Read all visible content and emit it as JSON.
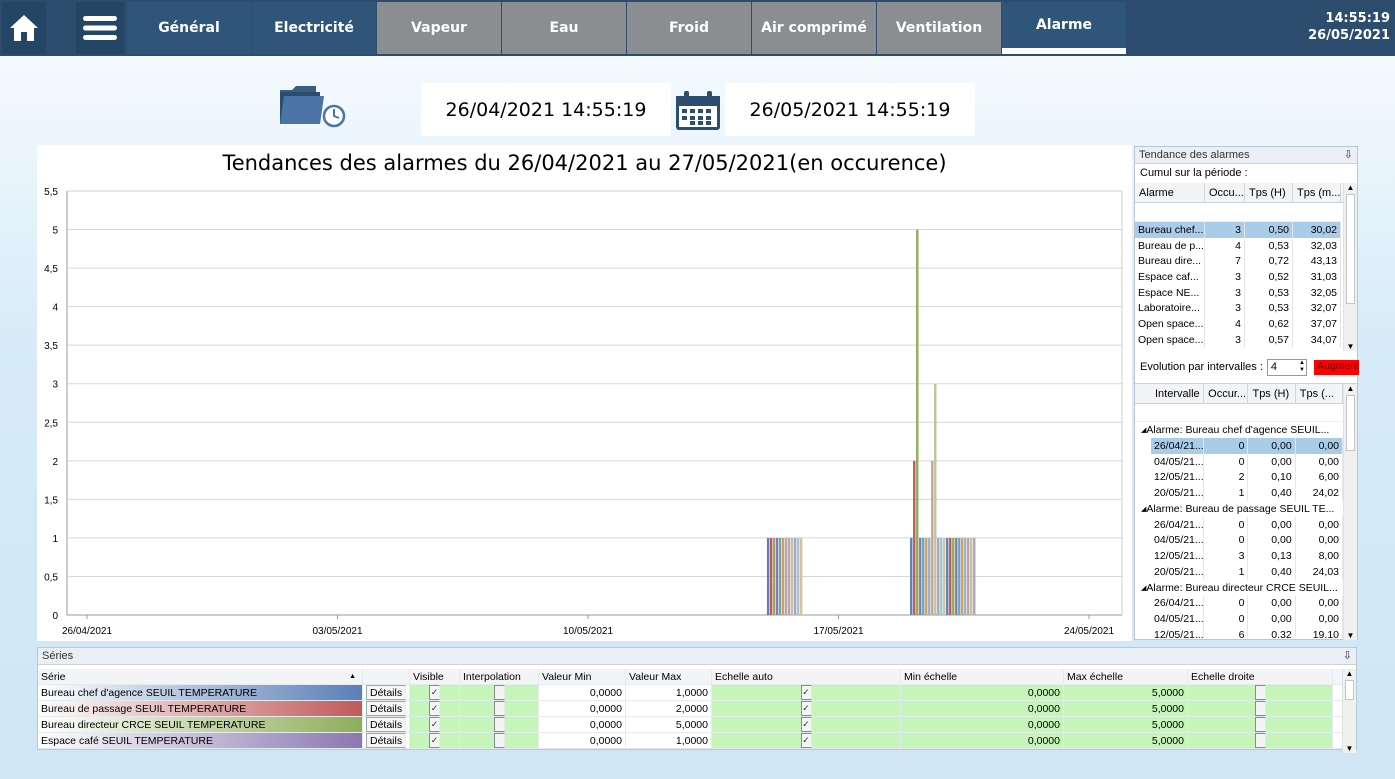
{
  "nav": {
    "tabs": [
      {
        "label": "Général",
        "state": "dark"
      },
      {
        "label": "Electricité",
        "state": "dark"
      },
      {
        "label": "Vapeur",
        "state": "gray"
      },
      {
        "label": "Eau",
        "state": "gray"
      },
      {
        "label": "Froid",
        "state": "gray"
      },
      {
        "label": "Air comprimé",
        "state": "gray"
      },
      {
        "label": "Ventilation",
        "state": "gray"
      },
      {
        "label": "Alarme",
        "state": "active"
      }
    ],
    "time": "14:55:19",
    "date": "26/05/2021"
  },
  "period": {
    "start": "26/04/2021 14:55:19",
    "end": "26/05/2021 14:55:19"
  },
  "chart_data": {
    "type": "bar",
    "title": "Tendances des alarmes du 26/04/2021 au 27/05/2021(en occurence)",
    "ylim": [
      0,
      5.5
    ],
    "yticks": [
      "0",
      "0,5",
      "1",
      "1,5",
      "2",
      "2,5",
      "3",
      "3,5",
      "4",
      "4,5",
      "5",
      "5,5"
    ],
    "xticks": [
      "26/04/2021",
      "03/05/2021",
      "10/05/2021",
      "17/05/2021",
      "24/05/2021"
    ],
    "grid": true,
    "colors": [
      "#5b7fb8",
      "#c05a5a",
      "#8fae5a",
      "#8a78b0",
      "#6aa8b8",
      "#d99a5a",
      "#9ab0c8",
      "#c8a0a0",
      "#b8c89a",
      "#b0a0c8",
      "#a0c8c8",
      "#d8c0a0"
    ],
    "groups": [
      {
        "date": "15/05/2021",
        "values": [
          1,
          1,
          1,
          1,
          1,
          1,
          1,
          1,
          1,
          1,
          1,
          1
        ]
      },
      {
        "date": "19/05/2021",
        "values": [
          1,
          2,
          5,
          1,
          1,
          1,
          1,
          2,
          3,
          1,
          1,
          1,
          1,
          1,
          1,
          1,
          1,
          1,
          1,
          1,
          1,
          1
        ]
      }
    ]
  },
  "trend_panel": {
    "title": "Tendance des alarmes",
    "subtitle": "Cumul sur la période :",
    "headers": [
      "Alarme",
      "Occu...",
      "Tps (H)",
      "Tps (m..."
    ],
    "rows": [
      [
        "Bureau chef...",
        "3",
        "0,50",
        "30,02"
      ],
      [
        "Bureau de p...",
        "4",
        "0,53",
        "32,03"
      ],
      [
        "Bureau dire...",
        "7",
        "0,72",
        "43,13"
      ],
      [
        "Espace caf...",
        "3",
        "0,52",
        "31,03"
      ],
      [
        "Espace NE...",
        "3",
        "0,53",
        "32,05"
      ],
      [
        "Laboratoire...",
        "3",
        "0,53",
        "32,07"
      ],
      [
        "Open space...",
        "4",
        "0,62",
        "37,07"
      ],
      [
        "Open space...",
        "3",
        "0,57",
        "34,07"
      ]
    ],
    "evolution_label": "Evolution par intervalles :",
    "evolution_value": "4",
    "evolution_button": "Augment",
    "interval_headers": [
      "Intervalle",
      "Occur...",
      "Tps (H)",
      "Tps (..."
    ],
    "interval_groups": [
      {
        "label": "Alarme: Bureau chef d'agence SEUIL...",
        "rows": [
          [
            "26/04/21...",
            "0",
            "0,00",
            "0,00"
          ],
          [
            "04/05/21...",
            "0",
            "0,00",
            "0,00"
          ],
          [
            "12/05/21...",
            "2",
            "0,10",
            "6,00"
          ],
          [
            "20/05/21...",
            "1",
            "0,40",
            "24,02"
          ]
        ]
      },
      {
        "label": "Alarme: Bureau de passage SEUIL TE...",
        "rows": [
          [
            "26/04/21...",
            "0",
            "0,00",
            "0,00"
          ],
          [
            "04/05/21...",
            "0",
            "0,00",
            "0,00"
          ],
          [
            "12/05/21...",
            "3",
            "0,13",
            "8,00"
          ],
          [
            "20/05/21...",
            "1",
            "0,40",
            "24,03"
          ]
        ]
      },
      {
        "label": "Alarme: Bureau directeur CRCE SEUIL...",
        "rows": [
          [
            "26/04/21...",
            "0",
            "0,00",
            "0,00"
          ],
          [
            "04/05/21...",
            "0",
            "0,00",
            "0,00"
          ],
          [
            "12/05/21...",
            "6",
            "0,32",
            "19,10"
          ]
        ]
      }
    ]
  },
  "series_panel": {
    "title": "Séries",
    "headers": [
      "Série",
      "",
      "Visible",
      "Interpolation",
      "Valeur Min",
      "Valeur Max",
      "Echelle auto",
      "Min échelle",
      "Max échelle",
      "Echelle droite"
    ],
    "details_label": "Détails",
    "rows": [
      {
        "name": "Bureau chef d'agence SEUIL TEMPERATURE",
        "color": "#5b7fb8",
        "visible": true,
        "interp": false,
        "vmin": "0,0000",
        "vmax": "1,0000",
        "auto": true,
        "emin": "0,0000",
        "emax": "5,0000",
        "right": false
      },
      {
        "name": "Bureau de passage SEUIL TEMPERATURE",
        "color": "#c05a5a",
        "visible": true,
        "interp": false,
        "vmin": "0,0000",
        "vmax": "2,0000",
        "auto": true,
        "emin": "0,0000",
        "emax": "5,0000",
        "right": false
      },
      {
        "name": "Bureau directeur CRCE SEUIL TEMPERATURE",
        "color": "#8fae5a",
        "visible": true,
        "interp": false,
        "vmin": "0,0000",
        "vmax": "5,0000",
        "auto": true,
        "emin": "0,0000",
        "emax": "5,0000",
        "right": false
      },
      {
        "name": "Espace café SEUIL TEMPERATURE",
        "color": "#8a78b0",
        "visible": true,
        "interp": false,
        "vmin": "0,0000",
        "vmax": "1,0000",
        "auto": true,
        "emin": "0,0000",
        "emax": "5,0000",
        "right": false
      }
    ]
  }
}
